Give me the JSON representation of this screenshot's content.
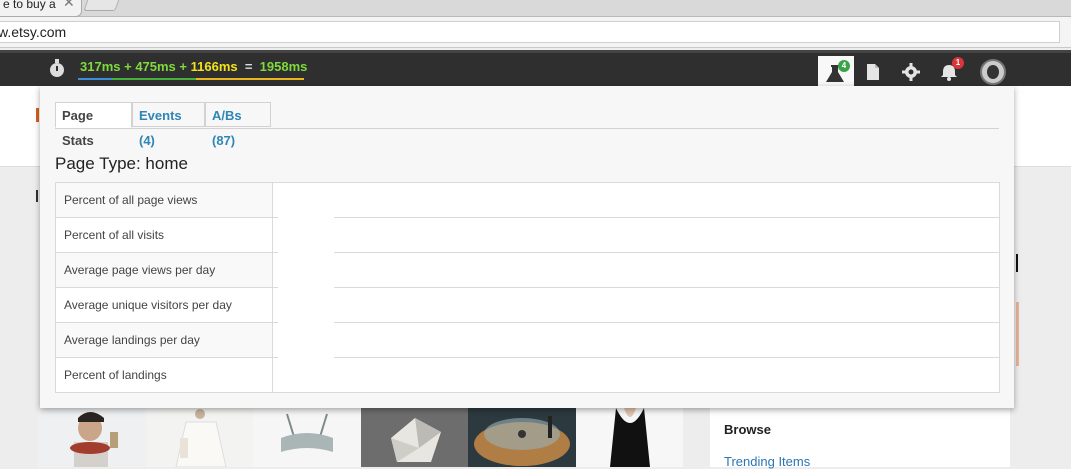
{
  "browser": {
    "tab_title": "e to buy a",
    "tab_close": "✕",
    "url": "w.etsy.com"
  },
  "adminbar": {
    "timing": {
      "t1": "317ms",
      "plus1": " + ",
      "t2": "475ms",
      "plus2": " + ",
      "t3": "1166ms",
      "eq": "  =  ",
      "total": "1958ms"
    },
    "icons": [
      {
        "name": "flask-icon",
        "badge": "4",
        "badge_color": "#3aa34a",
        "active": true
      },
      {
        "name": "document-icon"
      },
      {
        "name": "gear-icon"
      },
      {
        "name": "bell-icon",
        "badge": "1",
        "badge_color": "#d9353a"
      },
      {
        "name": "avatar"
      }
    ]
  },
  "panel": {
    "tabs": [
      {
        "label": "Page Stats",
        "active": true
      },
      {
        "label": "Events (4)"
      },
      {
        "label": "A/Bs (87)"
      }
    ],
    "page_type": "Page Type: home",
    "rows": [
      {
        "label": "Percent of all page views",
        "value": ""
      },
      {
        "label": "Percent of all visits",
        "value": ""
      },
      {
        "label": "Average page views per day",
        "value": ""
      },
      {
        "label": "Average unique visitors per day",
        "value": ""
      },
      {
        "label": "Average landings per day",
        "value": ""
      },
      {
        "label": "Percent of landings",
        "value": ""
      }
    ]
  },
  "site": {
    "browse_title": "Browse",
    "browse_link": "Trending Items"
  },
  "colors": {
    "accent_link": "#2d86b5",
    "timing_green": "#7ddb3c",
    "timing_yellow": "#f3e21a"
  }
}
